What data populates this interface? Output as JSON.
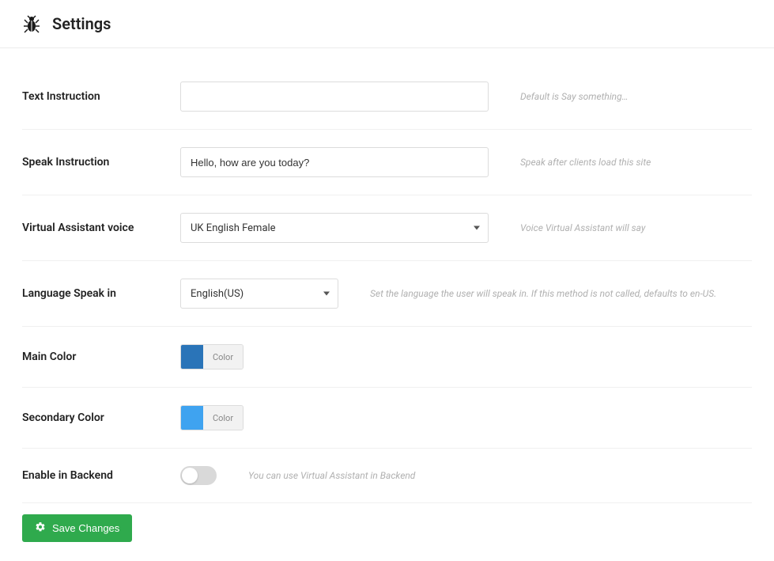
{
  "header": {
    "title": "Settings"
  },
  "fields": {
    "text_instruction": {
      "label": "Text Instruction",
      "value": "",
      "hint": "Default is Say something…"
    },
    "speak_instruction": {
      "label": "Speak Instruction",
      "value": "Hello, how are you today?",
      "hint": "Speak after clients load this site"
    },
    "voice": {
      "label": "Virtual Assistant voice",
      "value": "UK English Female",
      "hint": "Voice Virtual Assistant will say"
    },
    "language": {
      "label": "Language Speak in",
      "value": "English(US)",
      "hint": "Set the language the user will speak in. If this method is not called, defaults to en-US."
    },
    "main_color": {
      "label": "Main Color",
      "button": "Color",
      "swatch": "#2a74b8"
    },
    "secondary_color": {
      "label": "Secondary Color",
      "button": "Color",
      "swatch": "#3fa3f0"
    },
    "enable_backend": {
      "label": "Enable in Backend",
      "state": "off",
      "hint": "You can use Virtual Assistant in Backend"
    }
  },
  "actions": {
    "save": "Save Changes"
  }
}
